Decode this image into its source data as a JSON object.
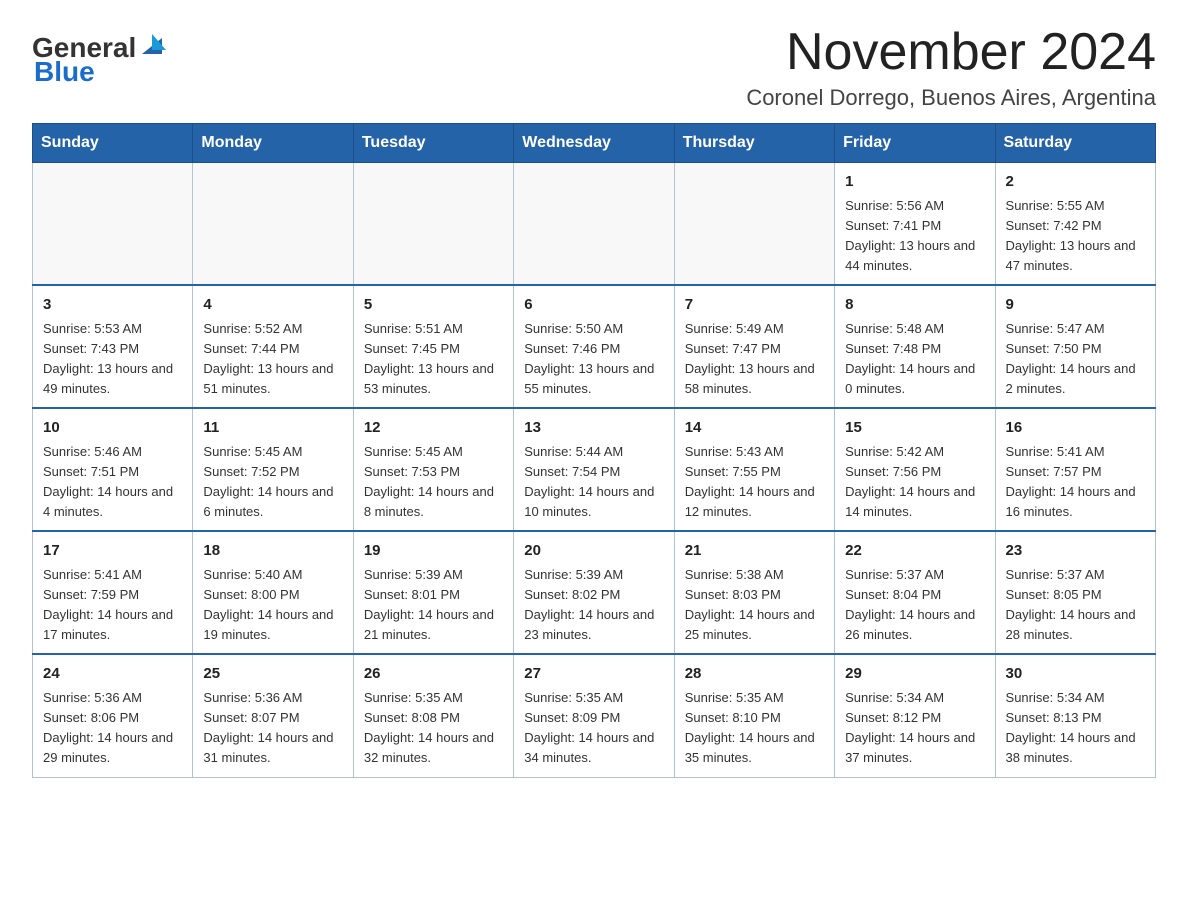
{
  "logo": {
    "general": "General",
    "blue": "Blue"
  },
  "title": "November 2024",
  "subtitle": "Coronel Dorrego, Buenos Aires, Argentina",
  "weekdays": [
    "Sunday",
    "Monday",
    "Tuesday",
    "Wednesday",
    "Thursday",
    "Friday",
    "Saturday"
  ],
  "weeks": [
    [
      {
        "day": "",
        "info": ""
      },
      {
        "day": "",
        "info": ""
      },
      {
        "day": "",
        "info": ""
      },
      {
        "day": "",
        "info": ""
      },
      {
        "day": "",
        "info": ""
      },
      {
        "day": "1",
        "info": "Sunrise: 5:56 AM\nSunset: 7:41 PM\nDaylight: 13 hours and 44 minutes."
      },
      {
        "day": "2",
        "info": "Sunrise: 5:55 AM\nSunset: 7:42 PM\nDaylight: 13 hours and 47 minutes."
      }
    ],
    [
      {
        "day": "3",
        "info": "Sunrise: 5:53 AM\nSunset: 7:43 PM\nDaylight: 13 hours and 49 minutes."
      },
      {
        "day": "4",
        "info": "Sunrise: 5:52 AM\nSunset: 7:44 PM\nDaylight: 13 hours and 51 minutes."
      },
      {
        "day": "5",
        "info": "Sunrise: 5:51 AM\nSunset: 7:45 PM\nDaylight: 13 hours and 53 minutes."
      },
      {
        "day": "6",
        "info": "Sunrise: 5:50 AM\nSunset: 7:46 PM\nDaylight: 13 hours and 55 minutes."
      },
      {
        "day": "7",
        "info": "Sunrise: 5:49 AM\nSunset: 7:47 PM\nDaylight: 13 hours and 58 minutes."
      },
      {
        "day": "8",
        "info": "Sunrise: 5:48 AM\nSunset: 7:48 PM\nDaylight: 14 hours and 0 minutes."
      },
      {
        "day": "9",
        "info": "Sunrise: 5:47 AM\nSunset: 7:50 PM\nDaylight: 14 hours and 2 minutes."
      }
    ],
    [
      {
        "day": "10",
        "info": "Sunrise: 5:46 AM\nSunset: 7:51 PM\nDaylight: 14 hours and 4 minutes."
      },
      {
        "day": "11",
        "info": "Sunrise: 5:45 AM\nSunset: 7:52 PM\nDaylight: 14 hours and 6 minutes."
      },
      {
        "day": "12",
        "info": "Sunrise: 5:45 AM\nSunset: 7:53 PM\nDaylight: 14 hours and 8 minutes."
      },
      {
        "day": "13",
        "info": "Sunrise: 5:44 AM\nSunset: 7:54 PM\nDaylight: 14 hours and 10 minutes."
      },
      {
        "day": "14",
        "info": "Sunrise: 5:43 AM\nSunset: 7:55 PM\nDaylight: 14 hours and 12 minutes."
      },
      {
        "day": "15",
        "info": "Sunrise: 5:42 AM\nSunset: 7:56 PM\nDaylight: 14 hours and 14 minutes."
      },
      {
        "day": "16",
        "info": "Sunrise: 5:41 AM\nSunset: 7:57 PM\nDaylight: 14 hours and 16 minutes."
      }
    ],
    [
      {
        "day": "17",
        "info": "Sunrise: 5:41 AM\nSunset: 7:59 PM\nDaylight: 14 hours and 17 minutes."
      },
      {
        "day": "18",
        "info": "Sunrise: 5:40 AM\nSunset: 8:00 PM\nDaylight: 14 hours and 19 minutes."
      },
      {
        "day": "19",
        "info": "Sunrise: 5:39 AM\nSunset: 8:01 PM\nDaylight: 14 hours and 21 minutes."
      },
      {
        "day": "20",
        "info": "Sunrise: 5:39 AM\nSunset: 8:02 PM\nDaylight: 14 hours and 23 minutes."
      },
      {
        "day": "21",
        "info": "Sunrise: 5:38 AM\nSunset: 8:03 PM\nDaylight: 14 hours and 25 minutes."
      },
      {
        "day": "22",
        "info": "Sunrise: 5:37 AM\nSunset: 8:04 PM\nDaylight: 14 hours and 26 minutes."
      },
      {
        "day": "23",
        "info": "Sunrise: 5:37 AM\nSunset: 8:05 PM\nDaylight: 14 hours and 28 minutes."
      }
    ],
    [
      {
        "day": "24",
        "info": "Sunrise: 5:36 AM\nSunset: 8:06 PM\nDaylight: 14 hours and 29 minutes."
      },
      {
        "day": "25",
        "info": "Sunrise: 5:36 AM\nSunset: 8:07 PM\nDaylight: 14 hours and 31 minutes."
      },
      {
        "day": "26",
        "info": "Sunrise: 5:35 AM\nSunset: 8:08 PM\nDaylight: 14 hours and 32 minutes."
      },
      {
        "day": "27",
        "info": "Sunrise: 5:35 AM\nSunset: 8:09 PM\nDaylight: 14 hours and 34 minutes."
      },
      {
        "day": "28",
        "info": "Sunrise: 5:35 AM\nSunset: 8:10 PM\nDaylight: 14 hours and 35 minutes."
      },
      {
        "day": "29",
        "info": "Sunrise: 5:34 AM\nSunset: 8:12 PM\nDaylight: 14 hours and 37 minutes."
      },
      {
        "day": "30",
        "info": "Sunrise: 5:34 AM\nSunset: 8:13 PM\nDaylight: 14 hours and 38 minutes."
      }
    ]
  ]
}
